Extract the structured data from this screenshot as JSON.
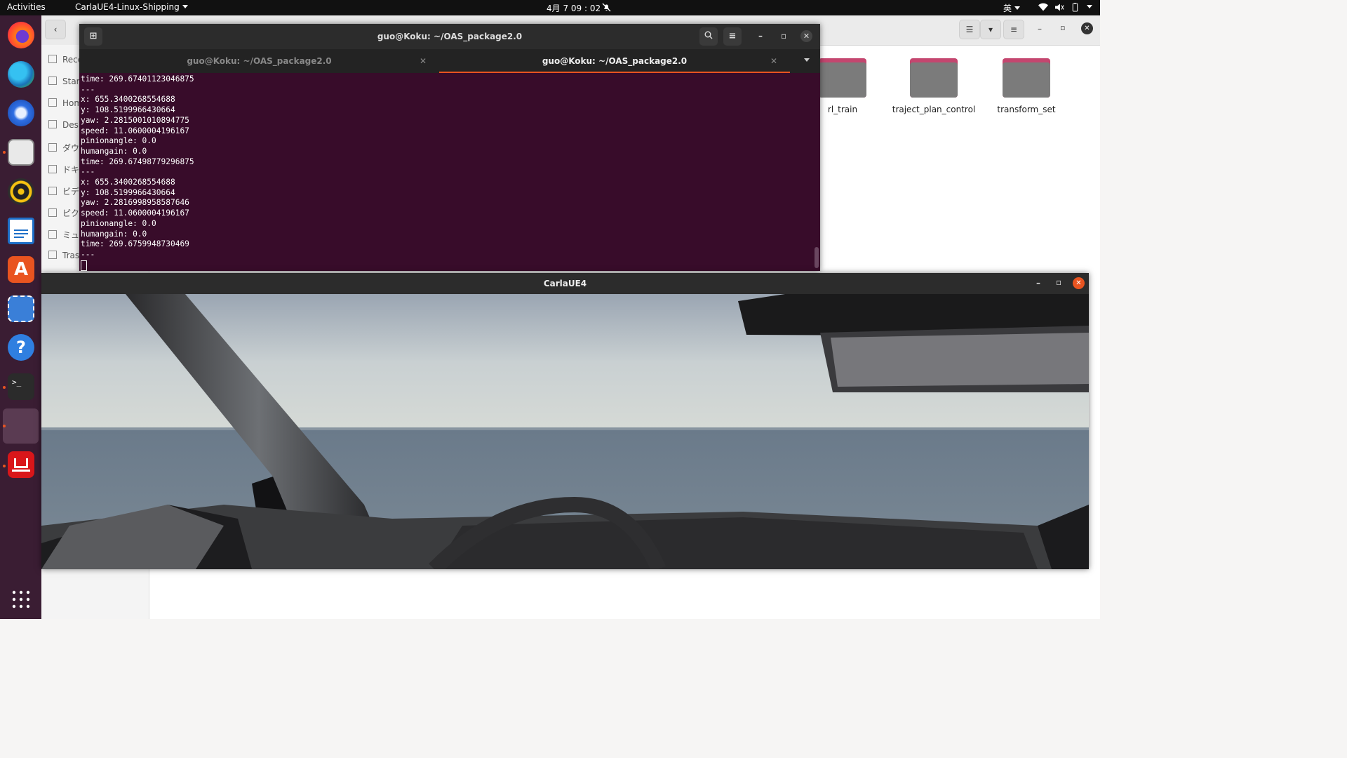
{
  "topbar": {
    "activities": "Activities",
    "app_menu": "CarlaUE4-Linux-Shipping",
    "clock": "4月 7 09 : 02",
    "input_method": "英"
  },
  "dock": {
    "apps": [
      "firefox-icon",
      "edge-icon",
      "thunderbird-icon",
      "files-icon",
      "rhythmbox-icon",
      "libreoffice-writer-icon",
      "ubuntu-software-icon",
      "screenshot-icon",
      "help-icon",
      "terminal-icon",
      "carla-icon",
      "app-icon"
    ],
    "show_apps": "show-applications-icon"
  },
  "files": {
    "sidebar": [
      {
        "label": "Rece",
        "icon": "recent-icon"
      },
      {
        "label": "Star",
        "icon": "star-icon"
      },
      {
        "label": "Hom",
        "icon": "home-icon"
      },
      {
        "label": "Desk",
        "icon": "desktop-icon"
      },
      {
        "label": "ダウ",
        "icon": "download-icon"
      },
      {
        "label": "ドキ",
        "icon": "document-icon"
      },
      {
        "label": "ビデ",
        "icon": "video-icon"
      },
      {
        "label": "ピク",
        "icon": "picture-icon"
      },
      {
        "label": "ミュ",
        "icon": "music-icon"
      },
      {
        "label": "Tras",
        "icon": "trash-icon"
      }
    ],
    "folders": [
      "rl_train",
      "traject_plan_control",
      "transform_set"
    ]
  },
  "terminal": {
    "title": "guo@Koku: ~/OAS_package2.0",
    "tabs": [
      {
        "label": "guo@Koku: ~/OAS_package2.0",
        "active": false
      },
      {
        "label": "guo@Koku: ~/OAS_package2.0",
        "active": true
      }
    ],
    "output": "time: 269.67401123046875\n---\nx: 655.3400268554688\ny: 108.5199966430664\nyaw: 2.2815001010894775\nspeed: 11.0600004196167\npinionangle: 0.0\nhumangain: 0.0\ntime: 269.67498779296875\n---\nx: 655.3400268554688\ny: 108.5199966430664\nyaw: 2.2816998958587646\nspeed: 11.0600004196167\npinionangle: 0.0\nhumangain: 0.0\ntime: 269.6759948730469\n---"
  },
  "carla": {
    "title": "CarlaUE4"
  },
  "colors": {
    "accent": "#e95420",
    "terminal_bg": "#380c2a",
    "dock_bg": "#3a1d33"
  }
}
